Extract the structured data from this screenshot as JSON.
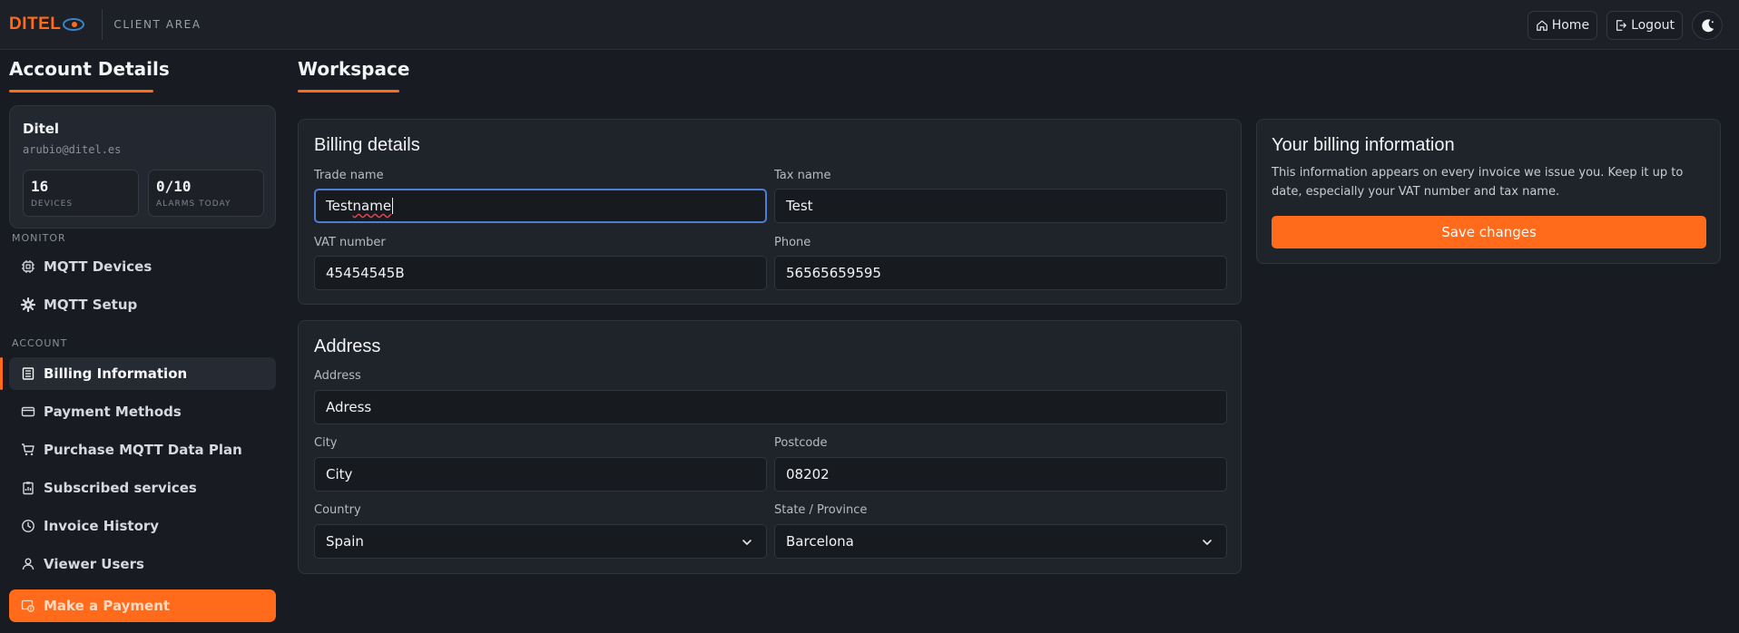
{
  "header": {
    "logo_text": "DITEL",
    "section": "CLIENT AREA",
    "home_label": "Home",
    "logout_label": "Logout",
    "brand_color": "#ff6b1a"
  },
  "sidebar": {
    "title": "Account Details",
    "profile": {
      "name": "Ditel",
      "email": "arubio@ditel.es",
      "stats": [
        {
          "value": "16",
          "label": "DEVICES"
        },
        {
          "value": "0/10",
          "label": "ALARMS TODAY"
        }
      ]
    },
    "groups": [
      {
        "label": "MONITOR",
        "items": [
          {
            "label": "MQTT Devices",
            "icon": "chip-icon"
          },
          {
            "label": "MQTT Setup",
            "icon": "gear-icon"
          }
        ]
      },
      {
        "label": "ACCOUNT",
        "items": [
          {
            "label": "Billing Information",
            "icon": "receipt-icon",
            "active": true
          },
          {
            "label": "Payment Methods",
            "icon": "credit-card-icon"
          },
          {
            "label": "Purchase MQTT Data Plan",
            "icon": "cart-icon"
          },
          {
            "label": "Subscribed services",
            "icon": "clipboard-icon"
          },
          {
            "label": "Invoice History",
            "icon": "clock-icon"
          },
          {
            "label": "Viewer Users",
            "icon": "user-icon"
          }
        ]
      }
    ],
    "pay_label": "Make a Payment"
  },
  "main": {
    "title": "Workspace",
    "billing": {
      "title": "Billing details",
      "trade_name": {
        "label": "Trade name",
        "value": "Test name"
      },
      "tax_name": {
        "label": "Tax name",
        "value": "Test"
      },
      "vat": {
        "label": "VAT number",
        "value": "45454545B"
      },
      "phone": {
        "label": "Phone",
        "value": "56565659595"
      }
    },
    "address": {
      "title": "Address",
      "address": {
        "label": "Address",
        "value": "Adress"
      },
      "city": {
        "label": "City",
        "value": "City"
      },
      "postcode": {
        "label": "Postcode",
        "value": "08202"
      },
      "country": {
        "label": "Country",
        "value": "Spain"
      },
      "state": {
        "label": "State / Province",
        "value": "Barcelona"
      }
    },
    "info": {
      "title": "Your billing information",
      "text": "This information appears on every invoice we issue you. Keep it up to date, especially your VAT number and tax name.",
      "save_label": "Save changes"
    }
  }
}
